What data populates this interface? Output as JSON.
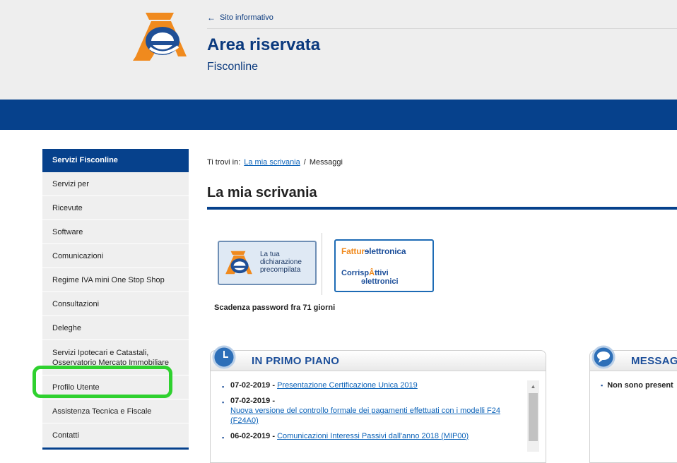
{
  "header": {
    "back_link": "Sito informativo",
    "title": "Area riservata",
    "subtitle": "Fisconline"
  },
  "sidebar": {
    "heading": "Servizi Fisconline",
    "items": [
      {
        "label": "Servizi per"
      },
      {
        "label": "Ricevute"
      },
      {
        "label": "Software"
      },
      {
        "label": "Comunicazioni"
      },
      {
        "label": "Regime IVA mini One Stop Shop"
      },
      {
        "label": "Consultazioni"
      },
      {
        "label": "Deleghe"
      },
      {
        "label": "Servizi Ipotecari e Catastali, Osservatorio Mercato Immobiliare"
      },
      {
        "label": "Profilo Utente"
      },
      {
        "label": "Assistenza Tecnica e Fiscale"
      },
      {
        "label": "Contatti"
      }
    ]
  },
  "breadcrumb": {
    "prefix": "Ti trovi in:",
    "link": "La mia scrivania",
    "separator": "/",
    "current": "Messaggi"
  },
  "page_title": "La mia scrivania",
  "banners": {
    "precompilata": "La tua dichiarazione precompilata",
    "fattura_a": "Fattur",
    "fattura_b": "lettronica",
    "corrisp_a": "Corrisp",
    "corrisp_b": "ttivi",
    "corrisp_c": "lettronici"
  },
  "password_notice": "Scadenza password fra 71 giorni",
  "primo_piano": {
    "title": "IN PRIMO PIANO",
    "items": [
      {
        "date": "07-02-2019 -",
        "link": "Presentazione Certificazione Unica 2019"
      },
      {
        "date": "07-02-2019 -",
        "link": "Nuova versione del controllo formale dei pagamenti effettuati con i modelli F24 (F24A0)"
      },
      {
        "date": "06-02-2019 -",
        "link": "Comunicazioni Interessi Passivi dall'anno 2018 (MIP00)"
      }
    ]
  },
  "messaggi": {
    "title": "MESSAG",
    "text": "Non sono present"
  },
  "colors": {
    "brand_blue": "#06418c",
    "title_blue": "#0b3a7e",
    "link_blue": "#0b62b8",
    "highlight_green": "#2fd12f",
    "accent_orange": "#f08a1e"
  }
}
